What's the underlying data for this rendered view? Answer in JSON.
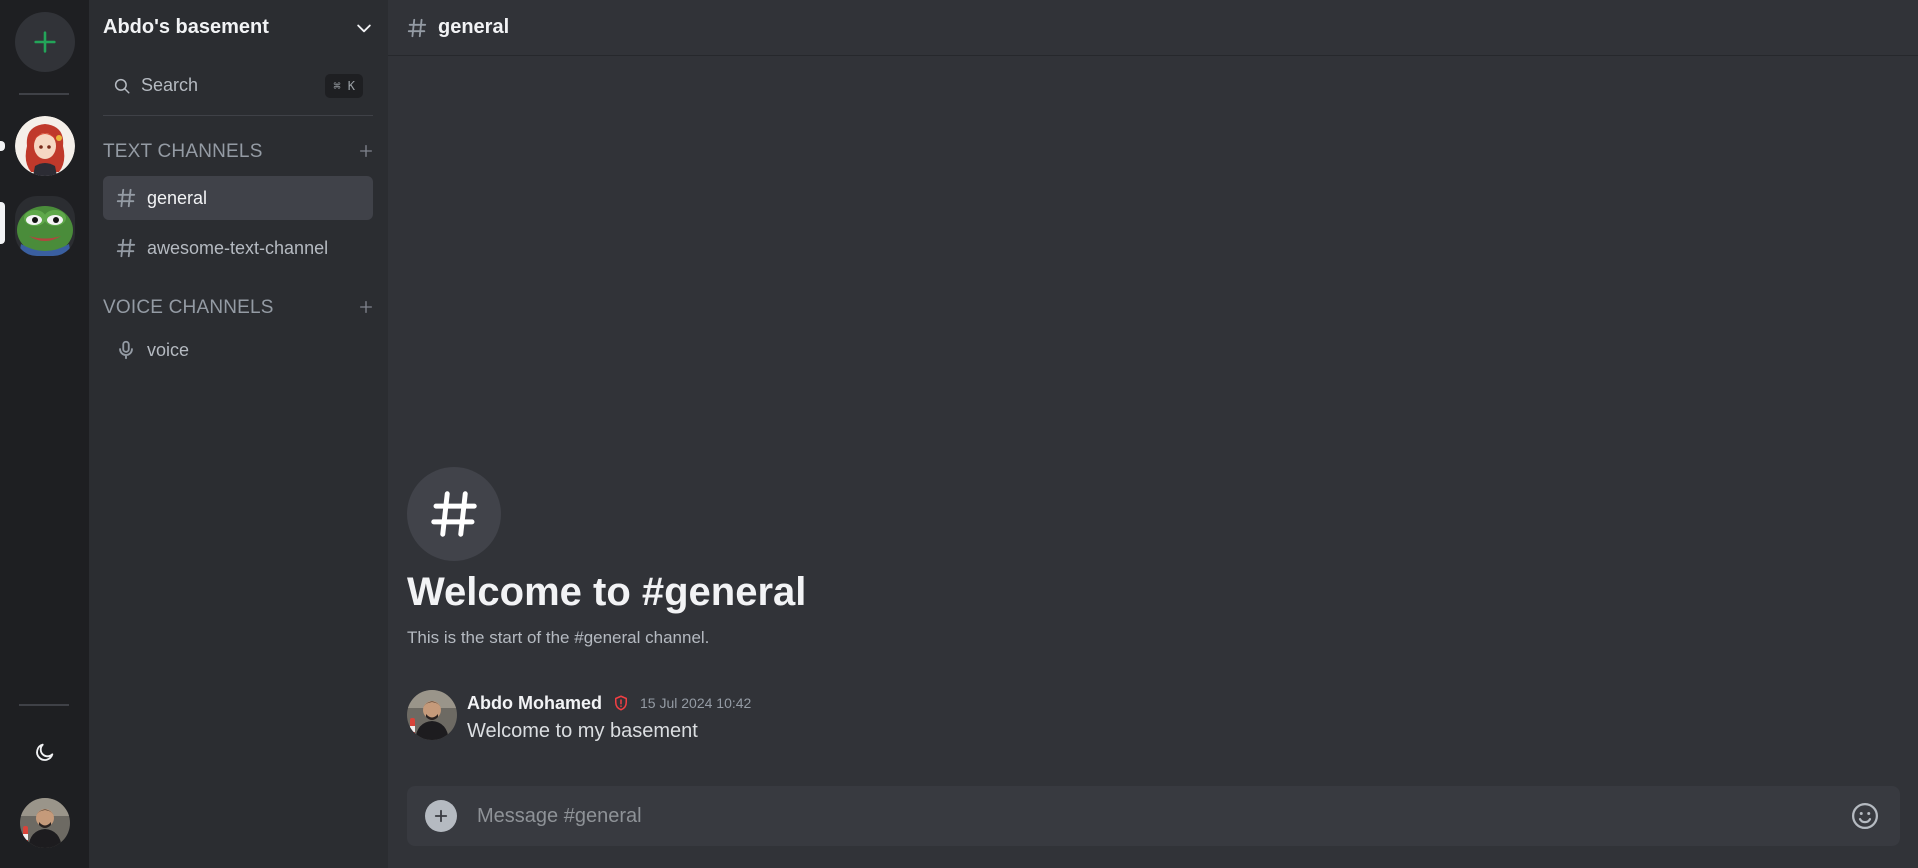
{
  "colors": {
    "accent_green": "#23a559",
    "moderator_badge": "#f23f43",
    "rail_bg": "#1e1f22",
    "sidebar_bg": "#2b2d31",
    "main_bg": "#313338"
  },
  "rail": {
    "add_server_icon": "plus-icon",
    "servers": [
      {
        "name": "anime-girl-server",
        "active": false
      },
      {
        "name": "pepe-frog-server",
        "active": true
      }
    ],
    "theme_toggle_icon": "moon-icon"
  },
  "sidebar": {
    "server_name": "Abdo's basement",
    "search": {
      "label": "Search",
      "shortcut": "⌘ K"
    },
    "text_channels_label": "TEXT CHANNELS",
    "voice_channels_label": "VOICE CHANNELS",
    "text_channels": [
      {
        "label": "general",
        "active": true
      },
      {
        "label": "awesome-text-channel",
        "active": false
      }
    ],
    "voice_channels": [
      {
        "label": "voice"
      }
    ]
  },
  "main": {
    "channel_name": "general",
    "welcome_title": "Welcome to #general",
    "welcome_subtitle": "This is the start of the #general channel.",
    "messages": [
      {
        "author": "Abdo Mohamed",
        "badge": "moderator-shield-icon",
        "timestamp": "15 Jul 2024 10:42",
        "text": "Welcome to my basement"
      }
    ],
    "composer_placeholder": "Message #general"
  }
}
